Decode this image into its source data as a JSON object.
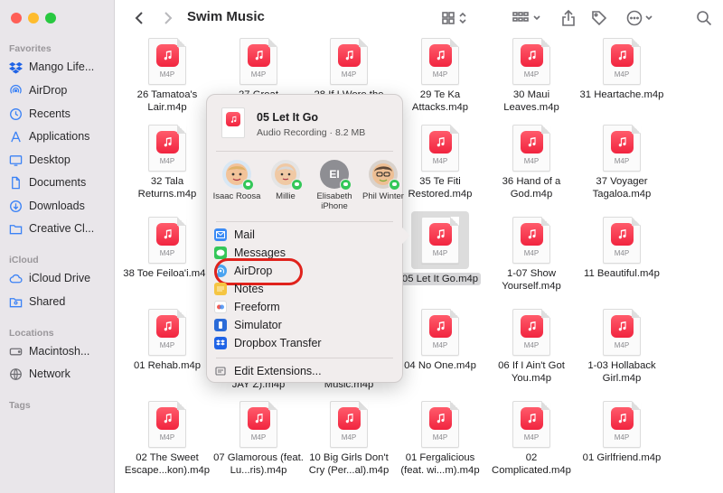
{
  "window": {
    "title": "Swim Music"
  },
  "sidebar": {
    "sections": [
      {
        "label": "Favorites",
        "items": [
          {
            "label": "Mango Life...",
            "icon": "dropbox-icon"
          },
          {
            "label": "AirDrop",
            "icon": "airdrop-icon"
          },
          {
            "label": "Recents",
            "icon": "clock-icon"
          },
          {
            "label": "Applications",
            "icon": "applications-icon"
          },
          {
            "label": "Desktop",
            "icon": "desktop-icon"
          },
          {
            "label": "Documents",
            "icon": "document-icon"
          },
          {
            "label": "Downloads",
            "icon": "download-icon"
          },
          {
            "label": "Creative Cl...",
            "icon": "folder-icon"
          }
        ]
      },
      {
        "label": "iCloud",
        "items": [
          {
            "label": "iCloud Drive",
            "icon": "cloud-icon"
          },
          {
            "label": "Shared",
            "icon": "shared-folder-icon"
          }
        ]
      },
      {
        "label": "Locations",
        "items": [
          {
            "label": "Macintosh...",
            "icon": "disk-icon"
          },
          {
            "label": "Network",
            "icon": "network-icon"
          }
        ]
      },
      {
        "label": "Tags",
        "items": []
      }
    ]
  },
  "files": [
    {
      "ext": "M4P",
      "name": "26 Tamatoa's Lair.m4p"
    },
    {
      "ext": "M4P",
      "name": "27 Great"
    },
    {
      "ext": "M4P",
      "name": "28 If I Were the"
    },
    {
      "ext": "M4P",
      "name": "29 Te Ka Attacks.m4p"
    },
    {
      "ext": "M4P",
      "name": "30 Maui Leaves.m4p"
    },
    {
      "ext": "M4P",
      "name": "31 Heartache.m4p"
    },
    {
      "ext": "M4P",
      "name": "32 Tala Returns.m4p"
    },
    {
      "ext": "M4P",
      "name": "35 Te Fiti Restored.m4p"
    },
    {
      "ext": "M4P",
      "name": "36 Hand of a God.m4p"
    },
    {
      "ext": "M4P",
      "name": "37 Voyager Tagaloa.m4p"
    },
    {
      "ext": "M4P",
      "name": "38 Toe Feiloa'i.m4p"
    },
    {
      "ext": "M4P",
      "name": "05 Let It Go.m4p"
    },
    {
      "ext": "M4P",
      "name": "1-07 Show Yourself.m4p"
    },
    {
      "ext": "M4P",
      "name": "11 Beautiful.m4p"
    },
    {
      "ext": "M4P",
      "name": "01 Rehab.m4p"
    },
    {
      "ext": "",
      "name": "JAY Z).m4p"
    },
    {
      "ext": "",
      "name": "Music.m4p"
    },
    {
      "ext": "M4P",
      "name": "04 No One.m4p"
    },
    {
      "ext": "M4P",
      "name": "06 If I Ain't Got You.m4p"
    },
    {
      "ext": "M4P",
      "name": "1-03 Hollaback Girl.m4p"
    },
    {
      "ext": "M4P",
      "name": "02 The Sweet Escape...kon).m4p"
    },
    {
      "ext": "M4P",
      "name": "07 Glamorous (feat. Lu...ris).m4p"
    },
    {
      "ext": "M4P",
      "name": "10 Big Girls Don't Cry (Per...al).m4p"
    },
    {
      "ext": "M4P",
      "name": "01 Fergalicious (feat. wi...m).m4p"
    },
    {
      "ext": "M4P",
      "name": "02 Complicated.m4p"
    },
    {
      "ext": "M4P",
      "name": "01 Girlfriend.m4p"
    }
  ],
  "share": {
    "file_title": "05 Let It Go",
    "file_subtitle": "Audio Recording · 8.2 MB",
    "file_ext": "M4P",
    "contacts": [
      {
        "name": "Isaac Roosa",
        "initials": ""
      },
      {
        "name": "Millie",
        "initials": ""
      },
      {
        "name": "Elisabeth iPhone",
        "initials": "EI"
      },
      {
        "name": "Phil Winter",
        "initials": ""
      }
    ],
    "menu": [
      {
        "label": "Mail",
        "icon": "mail-icon",
        "color": "#3b8bf5"
      },
      {
        "label": "Messages",
        "icon": "messages-icon",
        "color": "#34c759"
      },
      {
        "label": "AirDrop",
        "icon": "airdrop-icon",
        "color": "#4aa3f0"
      },
      {
        "label": "Notes",
        "icon": "notes-icon",
        "color": "#f5c542"
      },
      {
        "label": "Freeform",
        "icon": "freeform-icon",
        "color": "#ffffff"
      },
      {
        "label": "Simulator",
        "icon": "simulator-icon",
        "color": "#2b6bd8"
      },
      {
        "label": "Dropbox Transfer",
        "icon": "dropbox-icon",
        "color": "#1f63e6"
      },
      {
        "label": "Edit Extensions...",
        "icon": "extensions-icon",
        "color": "#8e8e93"
      }
    ],
    "highlight_color": "#e0221c"
  }
}
